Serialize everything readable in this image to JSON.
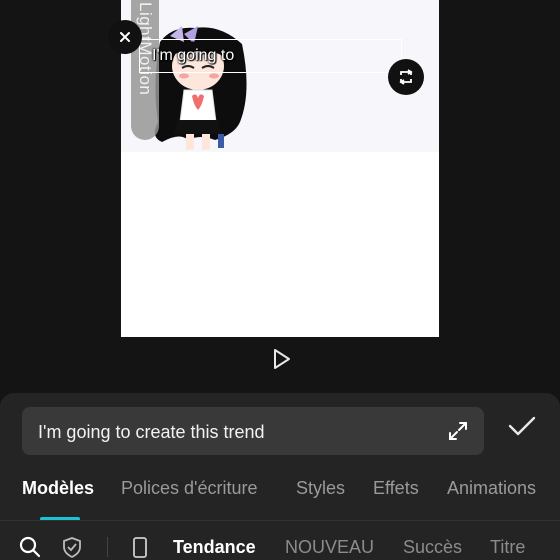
{
  "preview": {
    "overlay_text": "I'm going to",
    "watermark": "LightMotion"
  },
  "editor": {
    "text_value": "I'm going to create this trend"
  },
  "tabs": [
    {
      "label": "Modèles",
      "active": true
    },
    {
      "label": "Polices d'écriture",
      "active": false
    },
    {
      "label": "Styles",
      "active": false
    },
    {
      "label": "Effets",
      "active": false
    },
    {
      "label": "Animations",
      "active": false
    }
  ],
  "categories": [
    {
      "label": "Tendance",
      "active": true
    },
    {
      "label": "NOUVEAU",
      "active": false
    },
    {
      "label": "Succès",
      "active": false
    },
    {
      "label": "Titre",
      "active": false
    }
  ],
  "icons": {
    "close": "close-icon",
    "rotate": "rotate-icon",
    "play": "play-icon",
    "expand": "expand-icon",
    "confirm": "checkmark-icon",
    "search": "search-icon",
    "shield": "shield-icon",
    "phone": "phone-icon"
  },
  "colors": {
    "accent": "#1dc2d6",
    "background": "#141414",
    "panel": "#242424",
    "input": "#393939"
  }
}
